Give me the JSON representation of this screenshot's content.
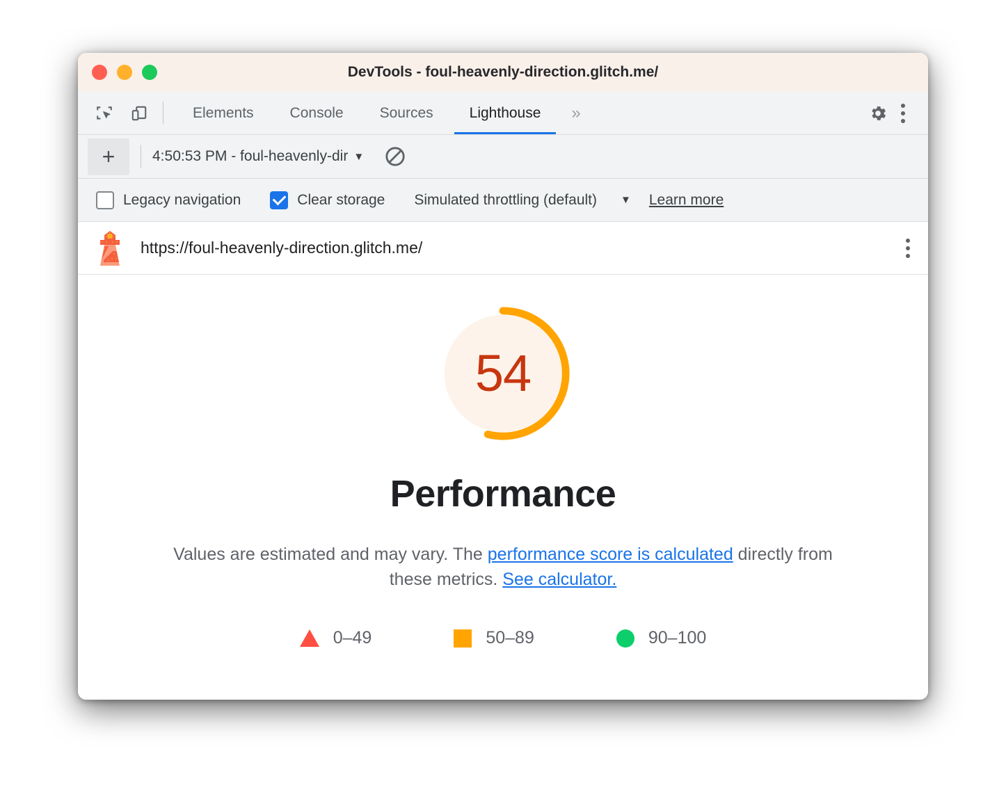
{
  "window": {
    "title": "DevTools - foul-heavenly-direction.glitch.me/",
    "traffic_lights": [
      "close",
      "minimize",
      "maximize"
    ]
  },
  "devtools": {
    "toolbar_icons": [
      "inspect-element-icon",
      "device-toolbar-icon"
    ],
    "tabs": [
      {
        "label": "Elements",
        "active": false
      },
      {
        "label": "Console",
        "active": false
      },
      {
        "label": "Sources",
        "active": false
      },
      {
        "label": "Lighthouse",
        "active": true
      }
    ],
    "overflow_label": "»",
    "settings_icon": "gear-icon",
    "more_icon": "more-vertical-icon",
    "active_tab_underline_color": "#1a73e8"
  },
  "lighthouse_toolbar": {
    "add_label": "+",
    "report_selector_value": "4:50:53 PM - foul-heavenly-dir",
    "report_selector_caret": "▼",
    "clear_icon": "no-entry-icon"
  },
  "settings": {
    "legacy_navigation": {
      "label": "Legacy navigation",
      "checked": false
    },
    "clear_storage": {
      "label": "Clear storage",
      "checked": true
    },
    "throttling": {
      "value": "Simulated throttling (default)",
      "caret": "▼"
    },
    "learn_more": "Learn more"
  },
  "url_row": {
    "icon": "lighthouse-icon",
    "url": "https://foul-heavenly-direction.glitch.me/",
    "menu_icon": "more-vertical-icon"
  },
  "report": {
    "category": "Performance",
    "score": "54",
    "disclaimer_prefix": "Values are estimated and may vary. The ",
    "disclaimer_link1": "performance score is calculated",
    "disclaimer_middle": " directly from these metrics. ",
    "disclaimer_link2": "See calculator.",
    "legend": [
      {
        "shape": "triangle",
        "label": "0–49",
        "color": "#ff4e42"
      },
      {
        "shape": "square",
        "label": "50–89",
        "color": "#ffa400"
      },
      {
        "shape": "circle",
        "label": "90–100",
        "color": "#0cce6a"
      }
    ]
  },
  "chart_data": {
    "type": "gauge",
    "title": "Performance",
    "value": 54,
    "range": [
      0,
      100
    ],
    "arc_sweep_degrees": 194,
    "arc_color": "#ffa400",
    "track_color": "#fdf3ea",
    "score_text_color": "#c7360f",
    "bands": [
      {
        "name": "0–49",
        "min": 0,
        "max": 49,
        "color": "#ff4e42"
      },
      {
        "name": "50–89",
        "min": 50,
        "max": 89,
        "color": "#ffa400"
      },
      {
        "name": "90–100",
        "min": 90,
        "max": 100,
        "color": "#0cce6a"
      }
    ]
  }
}
